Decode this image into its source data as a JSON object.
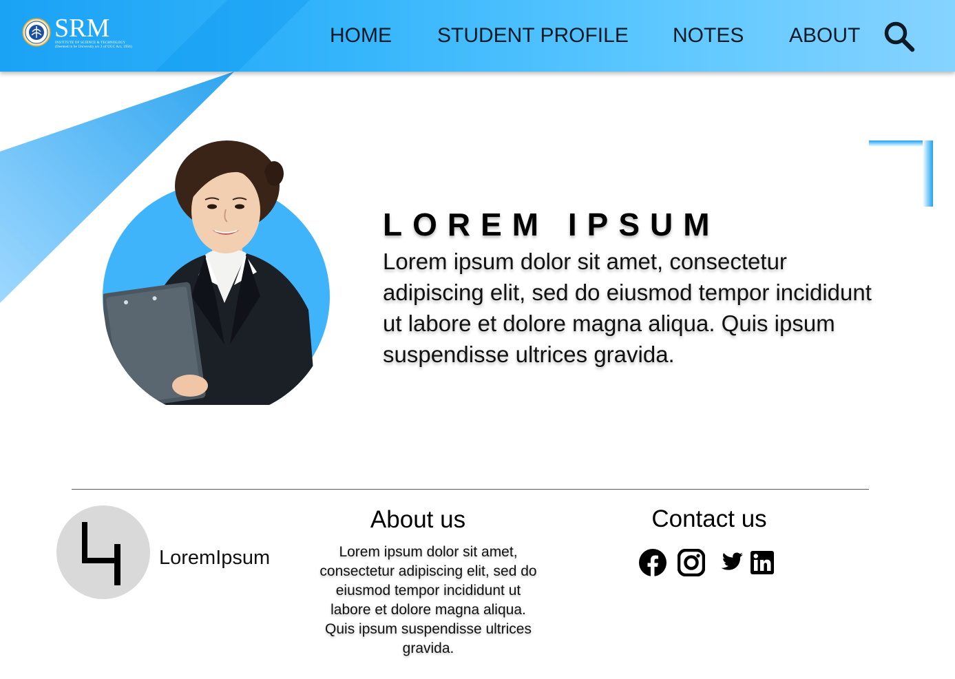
{
  "header": {
    "logo": {
      "name": "SRM",
      "subtitle_line1": "INSTITUTE OF SCIENCE & TECHNOLOGY",
      "subtitle_line2": "(Deemed to be University u/s 3 of UGC Act, 1956)"
    },
    "nav": [
      {
        "label": "HOME"
      },
      {
        "label": "STUDENT PROFILE"
      },
      {
        "label": "NOTES"
      },
      {
        "label": "ABOUT"
      }
    ],
    "search_icon": "search-icon"
  },
  "hero": {
    "title": "LOREM IPSUM",
    "text": "Lorem ipsum dolor sit amet, consectetur adipiscing elit, sed do eiusmod tempor incididunt ut labore et dolore magna aliqua. Quis ipsum suspendisse ultrices gravida.",
    "portrait": "student-portrait"
  },
  "footer": {
    "brand": {
      "name": "LoremIpsum",
      "mark_icon": "li-monogram"
    },
    "about": {
      "title": "About us",
      "text": "Lorem ipsum dolor sit amet, consectetur adipiscing elit, sed do eiusmod tempor incididunt ut labore et dolore magna aliqua. Quis ipsum suspendisse ultrices gravida."
    },
    "contact": {
      "title": "Contact us",
      "social": [
        "facebook-icon",
        "instagram-icon",
        "twitter-icon",
        "linkedin-icon"
      ]
    }
  },
  "colors": {
    "accent": "#1aa2f5",
    "accent_light": "#86d3ff",
    "portrait_circle": "#40b4fa",
    "brand_circle": "#d9d9d9",
    "nav_text": "#0c1a26"
  }
}
